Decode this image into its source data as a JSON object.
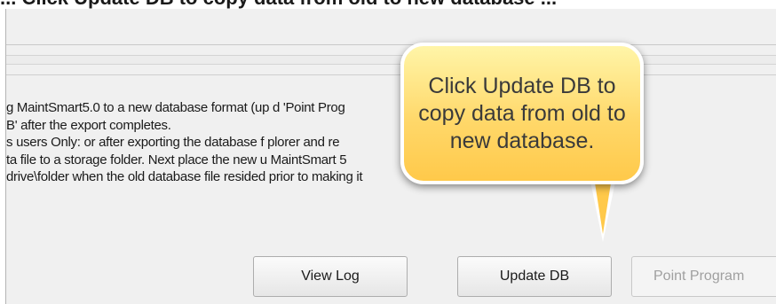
{
  "header": {
    "title": "... Click Update DB to copy data from old to new database ..."
  },
  "message": {
    "lines": [
      "g MaintSmart5.0 to a new database format (up                                        d 'Point Prog",
      "B' after the export completes.",
      "s users Only: or after exporting the database f                                      plorer and re",
      "ta file to a storage folder. Next place the new u                                     MaintSmart 5",
      "drive\\folder when the old database file resided prior to making it"
    ]
  },
  "callout": {
    "text": "Click Update DB to copy data from old to new database."
  },
  "buttons": {
    "view_log": "View Log",
    "update_db": "Update DB",
    "point_program": "Point Program"
  },
  "colors": {
    "callout_top": "#fff5a8",
    "callout_bottom": "#ffc94a",
    "window_bg": "#f0f0f0",
    "disabled_text": "#a0a0a0"
  }
}
